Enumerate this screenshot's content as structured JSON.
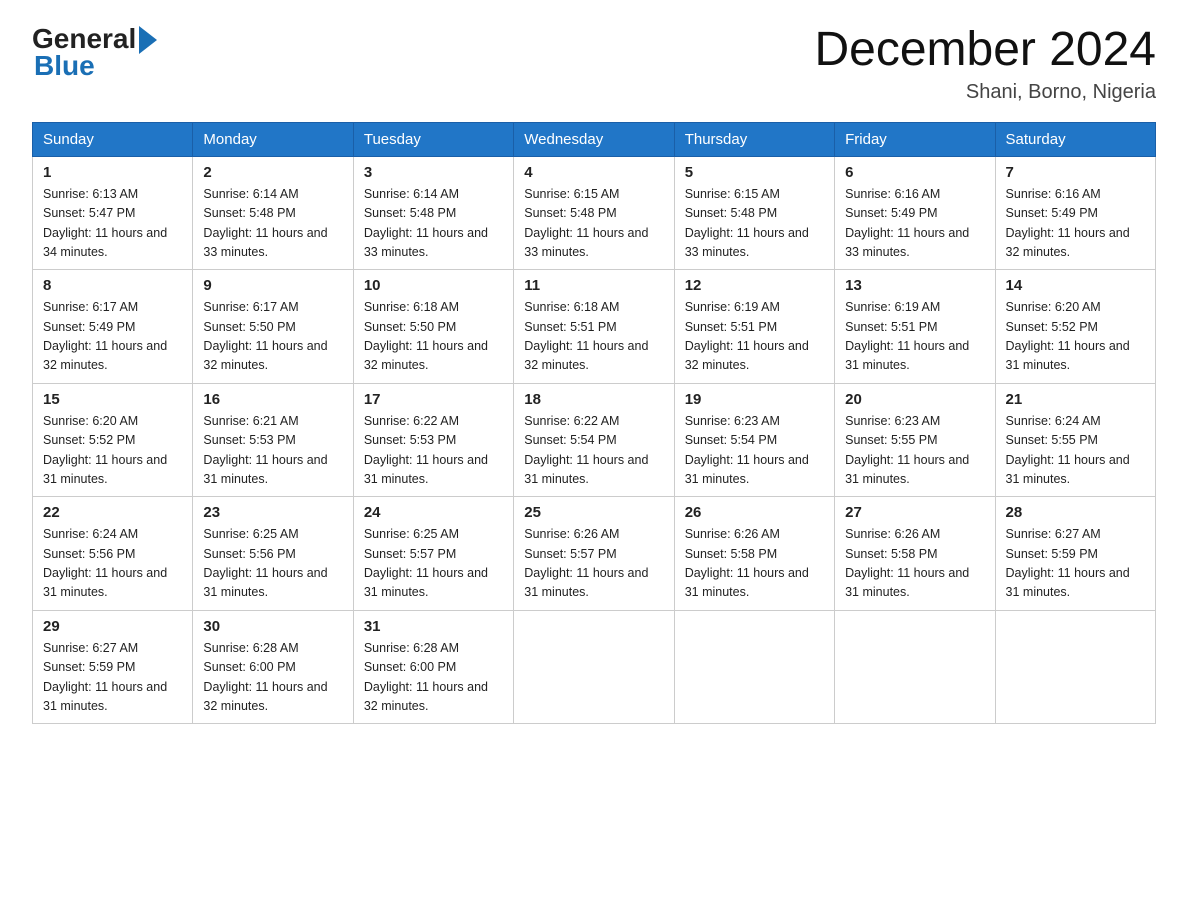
{
  "header": {
    "logo_text_general": "General",
    "logo_text_blue": "Blue",
    "title": "December 2024",
    "location": "Shani, Borno, Nigeria"
  },
  "weekdays": [
    "Sunday",
    "Monday",
    "Tuesday",
    "Wednesday",
    "Thursday",
    "Friday",
    "Saturday"
  ],
  "weeks": [
    [
      {
        "day": "1",
        "sunrise": "6:13 AM",
        "sunset": "5:47 PM",
        "daylight": "11 hours and 34 minutes."
      },
      {
        "day": "2",
        "sunrise": "6:14 AM",
        "sunset": "5:48 PM",
        "daylight": "11 hours and 33 minutes."
      },
      {
        "day": "3",
        "sunrise": "6:14 AM",
        "sunset": "5:48 PM",
        "daylight": "11 hours and 33 minutes."
      },
      {
        "day": "4",
        "sunrise": "6:15 AM",
        "sunset": "5:48 PM",
        "daylight": "11 hours and 33 minutes."
      },
      {
        "day": "5",
        "sunrise": "6:15 AM",
        "sunset": "5:48 PM",
        "daylight": "11 hours and 33 minutes."
      },
      {
        "day": "6",
        "sunrise": "6:16 AM",
        "sunset": "5:49 PM",
        "daylight": "11 hours and 33 minutes."
      },
      {
        "day": "7",
        "sunrise": "6:16 AM",
        "sunset": "5:49 PM",
        "daylight": "11 hours and 32 minutes."
      }
    ],
    [
      {
        "day": "8",
        "sunrise": "6:17 AM",
        "sunset": "5:49 PM",
        "daylight": "11 hours and 32 minutes."
      },
      {
        "day": "9",
        "sunrise": "6:17 AM",
        "sunset": "5:50 PM",
        "daylight": "11 hours and 32 minutes."
      },
      {
        "day": "10",
        "sunrise": "6:18 AM",
        "sunset": "5:50 PM",
        "daylight": "11 hours and 32 minutes."
      },
      {
        "day": "11",
        "sunrise": "6:18 AM",
        "sunset": "5:51 PM",
        "daylight": "11 hours and 32 minutes."
      },
      {
        "day": "12",
        "sunrise": "6:19 AM",
        "sunset": "5:51 PM",
        "daylight": "11 hours and 32 minutes."
      },
      {
        "day": "13",
        "sunrise": "6:19 AM",
        "sunset": "5:51 PM",
        "daylight": "11 hours and 31 minutes."
      },
      {
        "day": "14",
        "sunrise": "6:20 AM",
        "sunset": "5:52 PM",
        "daylight": "11 hours and 31 minutes."
      }
    ],
    [
      {
        "day": "15",
        "sunrise": "6:20 AM",
        "sunset": "5:52 PM",
        "daylight": "11 hours and 31 minutes."
      },
      {
        "day": "16",
        "sunrise": "6:21 AM",
        "sunset": "5:53 PM",
        "daylight": "11 hours and 31 minutes."
      },
      {
        "day": "17",
        "sunrise": "6:22 AM",
        "sunset": "5:53 PM",
        "daylight": "11 hours and 31 minutes."
      },
      {
        "day": "18",
        "sunrise": "6:22 AM",
        "sunset": "5:54 PM",
        "daylight": "11 hours and 31 minutes."
      },
      {
        "day": "19",
        "sunrise": "6:23 AM",
        "sunset": "5:54 PM",
        "daylight": "11 hours and 31 minutes."
      },
      {
        "day": "20",
        "sunrise": "6:23 AM",
        "sunset": "5:55 PM",
        "daylight": "11 hours and 31 minutes."
      },
      {
        "day": "21",
        "sunrise": "6:24 AM",
        "sunset": "5:55 PM",
        "daylight": "11 hours and 31 minutes."
      }
    ],
    [
      {
        "day": "22",
        "sunrise": "6:24 AM",
        "sunset": "5:56 PM",
        "daylight": "11 hours and 31 minutes."
      },
      {
        "day": "23",
        "sunrise": "6:25 AM",
        "sunset": "5:56 PM",
        "daylight": "11 hours and 31 minutes."
      },
      {
        "day": "24",
        "sunrise": "6:25 AM",
        "sunset": "5:57 PM",
        "daylight": "11 hours and 31 minutes."
      },
      {
        "day": "25",
        "sunrise": "6:26 AM",
        "sunset": "5:57 PM",
        "daylight": "11 hours and 31 minutes."
      },
      {
        "day": "26",
        "sunrise": "6:26 AM",
        "sunset": "5:58 PM",
        "daylight": "11 hours and 31 minutes."
      },
      {
        "day": "27",
        "sunrise": "6:26 AM",
        "sunset": "5:58 PM",
        "daylight": "11 hours and 31 minutes."
      },
      {
        "day": "28",
        "sunrise": "6:27 AM",
        "sunset": "5:59 PM",
        "daylight": "11 hours and 31 minutes."
      }
    ],
    [
      {
        "day": "29",
        "sunrise": "6:27 AM",
        "sunset": "5:59 PM",
        "daylight": "11 hours and 31 minutes."
      },
      {
        "day": "30",
        "sunrise": "6:28 AM",
        "sunset": "6:00 PM",
        "daylight": "11 hours and 32 minutes."
      },
      {
        "day": "31",
        "sunrise": "6:28 AM",
        "sunset": "6:00 PM",
        "daylight": "11 hours and 32 minutes."
      },
      null,
      null,
      null,
      null
    ]
  ]
}
